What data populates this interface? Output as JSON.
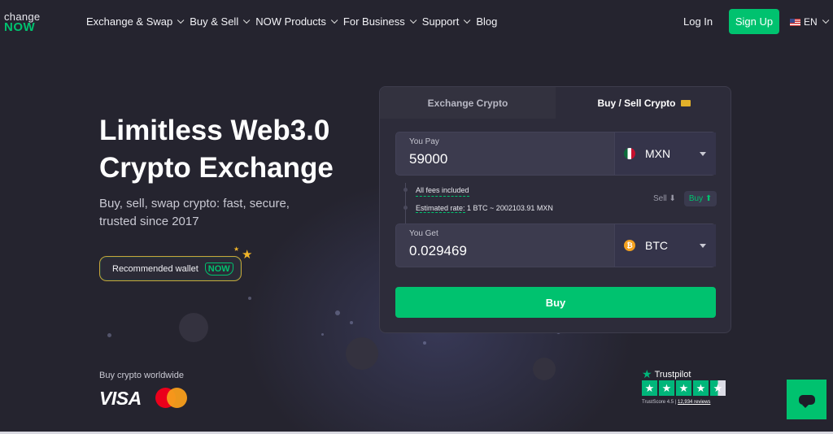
{
  "header": {
    "logo_top": "change",
    "logo_bottom": "NOW",
    "nav": [
      {
        "label": "Exchange & Swap",
        "dropdown": true
      },
      {
        "label": "Buy & Sell",
        "dropdown": true
      },
      {
        "label": "NOW Products",
        "dropdown": true
      },
      {
        "label": "For Business",
        "dropdown": true
      },
      {
        "label": "Support",
        "dropdown": true
      },
      {
        "label": "Blog",
        "dropdown": false
      }
    ],
    "login_label": "Log In",
    "signup_label": "Sign Up",
    "language": "EN"
  },
  "hero": {
    "title_line1": "Limitless Web3.0",
    "title_line2": "Crypto Exchange",
    "subtitle": "Buy, sell, swap crypto: fast, secure, trusted since 2017",
    "recommended_label": "Recommended wallet",
    "recommended_badge": "NOW",
    "buy_worldwide": "Buy crypto worldwide",
    "visa": "VISA"
  },
  "widget": {
    "tab_exchange": "Exchange Crypto",
    "tab_buy_sell": "Buy / Sell Crypto",
    "you_pay_label": "You Pay",
    "you_pay_value": "59000",
    "pay_currency": "MXN",
    "fees_text": "All fees included",
    "rate_label": "Estimated rate:",
    "rate_value": "1 BTC ~ 2002103.91 MXN",
    "sell_label": "Sell",
    "buy_toggle_label": "Buy",
    "you_get_label": "You Get",
    "you_get_value": "0.029469",
    "get_currency": "BTC",
    "buy_button": "Buy"
  },
  "trustpilot": {
    "name": "Trustpilot",
    "score_label": "TrustScore 4.5",
    "reviews": "12,934 reviews",
    "rating": 4.5
  },
  "colors": {
    "accent": "#00c26f",
    "background": "#25242f",
    "trustpilot_green": "#00b67a"
  }
}
